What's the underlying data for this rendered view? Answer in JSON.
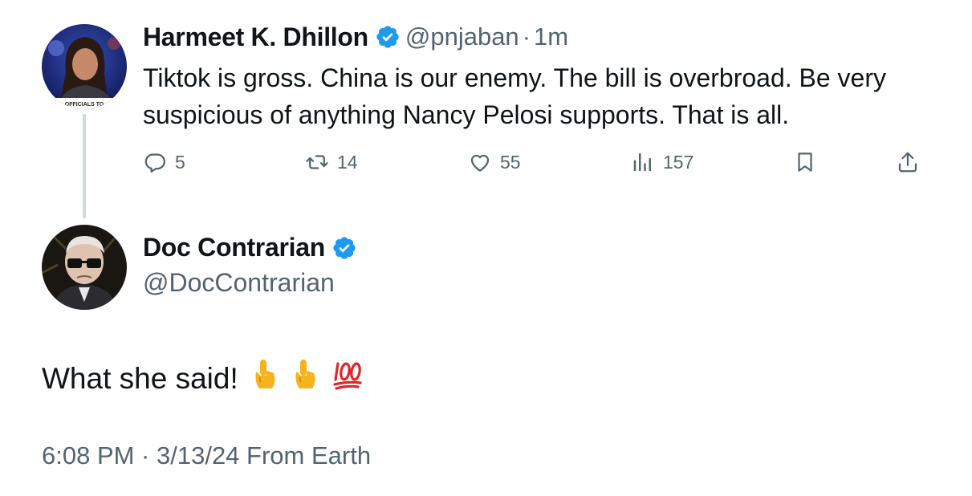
{
  "quoted_tweet": {
    "author_name": "Harmeet K. Dhillon",
    "handle": "@pnjaban",
    "separator": "·",
    "time_ago": "1m",
    "avatar_caption": "OFFICIALS TO",
    "text": "Tiktok is gross. China is our enemy. The bill is overbroad. Be very suspicious of anything Nancy Pelosi supports. That is all.",
    "actions": {
      "replies": "5",
      "reposts": "14",
      "likes": "55",
      "views": "157"
    }
  },
  "reply_tweet": {
    "author_name": "Doc Contrarian",
    "handle": "@DocContrarian",
    "text": "What she said!",
    "emojis": [
      "pointing-up",
      "pointing-up",
      "hundred-points"
    ],
    "timestamp": "6:08 PM · 3/13/24 From Earth"
  },
  "colors": {
    "text_primary": "#0f1419",
    "text_secondary": "#536471",
    "verified_blue": "#1d9bf0",
    "thread_line": "#cfd9de",
    "hundred_red": "#e0242a"
  }
}
